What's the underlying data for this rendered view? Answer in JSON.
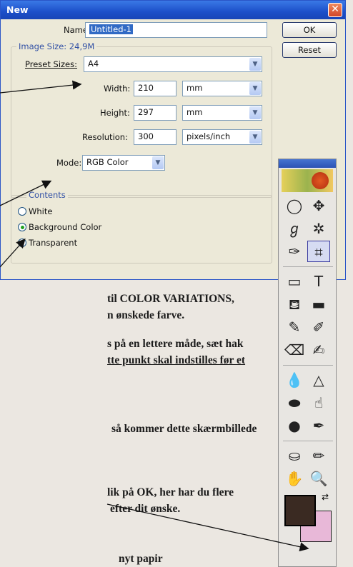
{
  "dialog": {
    "title": "New",
    "close_icon": "close-icon",
    "name_label": "Name:",
    "name_value": "Untitled-1",
    "image_size_label": "Image Size: 24,9M",
    "preset_label": "Preset Sizes:",
    "preset_value": "A4",
    "width_label": "Width:",
    "width_value": "210",
    "width_unit": "mm",
    "height_label": "Height:",
    "height_value": "297",
    "height_unit": "mm",
    "resolution_label": "Resolution:",
    "resolution_value": "300",
    "resolution_unit": "pixels/inch",
    "mode_label": "Mode:",
    "mode_value": "RGB Color",
    "contents_label": "Contents",
    "contents_options": [
      {
        "label": "White",
        "selected": false
      },
      {
        "label": "Background Color",
        "selected": true
      },
      {
        "label": "Transparent",
        "selected": false
      }
    ],
    "ok_label": "OK",
    "reset_label": "Reset"
  },
  "document_text": [
    "til COLOR VARIATIONS,",
    "n ønskede farve.",
    "s på en lettere måde, sæt hak",
    "tte punkt skal indstilles før et",
    "så kommer dette skærmbillede",
    "lik på OK, her har du flere",
    "efter dit ønske.",
    "nyt papir"
  ],
  "toolbox": {
    "colors": {
      "foreground": "#3a2a22",
      "background": "#e8b8d8"
    }
  }
}
